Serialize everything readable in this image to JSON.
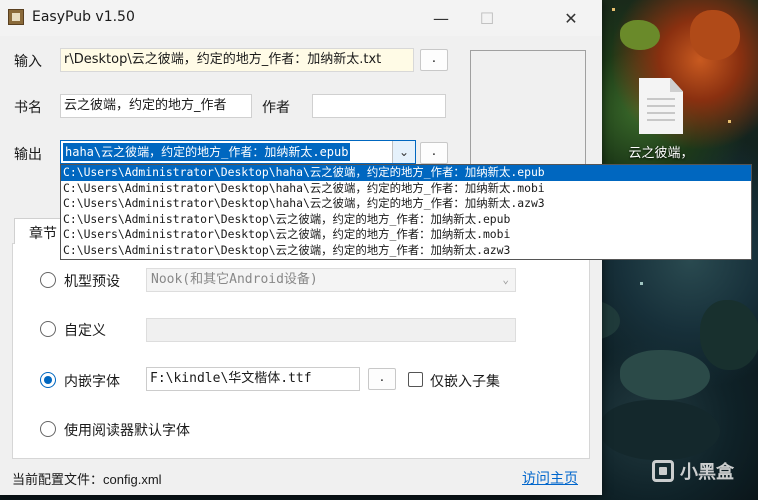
{
  "window": {
    "title": "EasyPub v1.50",
    "controls": {
      "minimize": "—",
      "maximize": "☐",
      "close": "✕"
    }
  },
  "form": {
    "input_label": "输入",
    "input_value": "r\\Desktop\\云之彼端，约定的地方_作者：加纳新太.txt",
    "browse_label": ".",
    "title_label": "书名",
    "title_value": "云之彼端，约定的地方_作者",
    "author_label": "作者",
    "author_value": "",
    "output_label": "输出",
    "output_value": "haha\\云之彼端，约定的地方_作者：加纳新太.epub",
    "output_browse_label": "."
  },
  "output_dropdown": {
    "items": [
      "C:\\Users\\Administrator\\Desktop\\haha\\云之彼端，约定的地方_作者：加纳新太.epub",
      "C:\\Users\\Administrator\\Desktop\\haha\\云之彼端，约定的地方_作者：加纳新太.mobi",
      "C:\\Users\\Administrator\\Desktop\\haha\\云之彼端，约定的地方_作者：加纳新太.azw3",
      "C:\\Users\\Administrator\\Desktop\\云之彼端，约定的地方_作者：加纳新太.epub",
      "C:\\Users\\Administrator\\Desktop\\云之彼端，约定的地方_作者：加纳新太.mobi",
      "C:\\Users\\Administrator\\Desktop\\云之彼端，约定的地方_作者：加纳新太.azw3"
    ],
    "selected_index": 0
  },
  "tab": {
    "label": "章节"
  },
  "options": {
    "device_preset_label": "机型预设",
    "device_preset_value": "Nook(和其它Android设备)",
    "custom_label": "自定义",
    "embed_font_label": "内嵌字体",
    "embed_font_value": "F:\\kindle\\华文楷体.ttf",
    "font_browse_label": ".",
    "subset_label": "仅嵌入子集",
    "default_font_label": "使用阅读器默认字体"
  },
  "status": {
    "config_label": "当前配置文件：",
    "config_value": "config.xml",
    "homepage_link": "访问主页"
  },
  "desktop": {
    "file_label": "云之彼端，",
    "watermark": "小黑盒"
  },
  "colors": {
    "accent": "#0067c0",
    "link": "#0066cc"
  }
}
